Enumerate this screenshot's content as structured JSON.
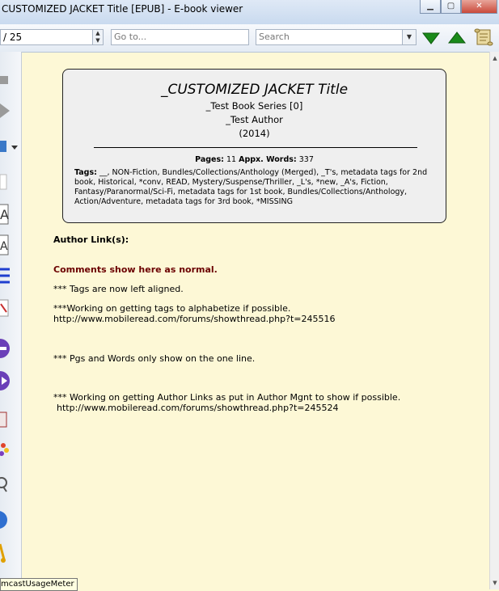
{
  "window": {
    "title": "CUSTOMIZED JACKET Title [EPUB] - E-book viewer"
  },
  "toolbar": {
    "page_value": "/ 25",
    "goto_placeholder": "Go to...",
    "search_placeholder": "Search"
  },
  "jacket": {
    "title": "_CUSTOMIZED JACKET Title",
    "series": "_Test Book Series [0]",
    "author": "_Test Author",
    "year": "(2014)",
    "pages_label": "Pages:",
    "pages_value": "11",
    "words_label": "Appx. Words:",
    "words_value": "337",
    "tags_label": "Tags:",
    "tags_value": "__, NON-Fiction, Bundles/Collections/Anthology (Merged), _T's, metadata tags for 2nd book, Historical, *conv, READ, Mystery/Suspense/Thriller, _L's, *new, _A's, Fiction, Fantasy/Paranormal/Sci-Fi, metadata tags for 1st book, Bundles/Collections/Anthology, Action/Adventure, metadata tags for 3rd book, *MISSING"
  },
  "content": {
    "author_links_label": "Author Link(s):",
    "comments_heading": "Comments show here as normal.",
    "line1": "*** Tags are now left aligned.",
    "line2": "***Working on getting tags to alphabetize if possible.",
    "line2_url": "http://www.mobileread.com/forums/showthread.php?t=245516",
    "line3": "*** Pgs and Words only show on the one line.",
    "line4": "*** Working on getting Author Links as put in Author Mgnt to show if possible.",
    "line4_url": "http://www.mobileread.com/forums/showthread.php?t=245524"
  },
  "tooltip": {
    "text": "mcastUsageMeter"
  },
  "colors": {
    "comments": "#6b0000",
    "background": "#fdf8d6",
    "nav_green": "#1a8a1a"
  }
}
